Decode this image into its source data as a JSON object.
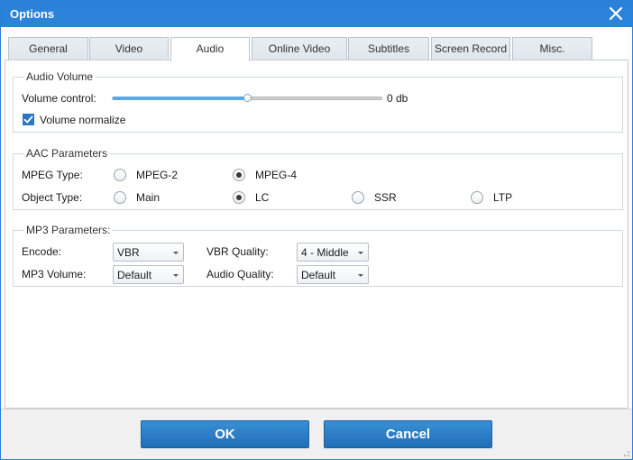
{
  "window": {
    "title": "Options"
  },
  "tabs": [
    {
      "label": "General"
    },
    {
      "label": "Video"
    },
    {
      "label": "Audio"
    },
    {
      "label": "Online Video"
    },
    {
      "label": "Subtitles"
    },
    {
      "label": "Screen Record"
    },
    {
      "label": "Misc."
    }
  ],
  "active_tab": "Audio",
  "audio_volume": {
    "legend": "Audio Volume",
    "volume_label": "Volume control:",
    "volume_value": "0 db",
    "slider_fraction": 0.5,
    "normalize_label": "Volume normalize",
    "normalize_checked": true
  },
  "aac": {
    "legend": "AAC Parameters",
    "mpeg_type_label": "MPEG Type:",
    "mpeg_options": [
      "MPEG-2",
      "MPEG-4"
    ],
    "mpeg_selected": "MPEG-4",
    "object_type_label": "Object Type:",
    "object_options": [
      "Main",
      "LC",
      "SSR",
      "LTP"
    ],
    "object_selected": "LC"
  },
  "mp3": {
    "legend": "MP3 Parameters:",
    "encode_label": "Encode:",
    "encode_value": "VBR",
    "vbr_quality_label": "VBR Quality:",
    "vbr_quality_value": "4 - Middle",
    "mp3_volume_label": "MP3 Volume:",
    "mp3_volume_value": "Default",
    "audio_quality_label": "Audio Quality:",
    "audio_quality_value": "Default"
  },
  "buttons": {
    "ok": "OK",
    "cancel": "Cancel"
  },
  "colors": {
    "titlebar": "#2b82d9",
    "button": "#2a7fc8",
    "slider_fill": "#5aa9e6"
  },
  "icons": {
    "close": "close-icon",
    "checkmark": "checkmark-icon",
    "dropdown": "chevron-down-icon"
  }
}
